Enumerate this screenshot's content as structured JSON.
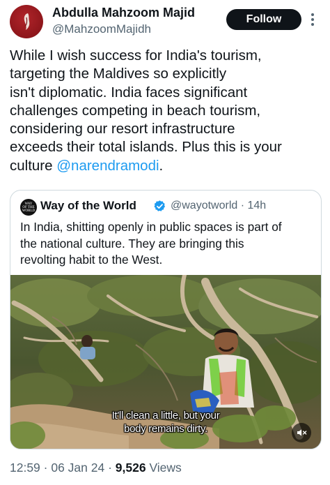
{
  "author": {
    "name": "Abdulla Mahzoom Majid",
    "handle": "@MahzoomMajidh",
    "avatar_color": "#8e161b"
  },
  "follow_label": "Follow",
  "tweet": {
    "lines": [
      "While I wish success for India's tourism,",
      "targeting the Maldives so explicitly",
      "isn't diplomatic. India faces significant",
      "challenges competing in beach tourism,",
      "considering our resort infrastructure",
      "exceeds their total islands. Plus this is your"
    ],
    "last_line_prefix": "culture ",
    "mention": "@narendramodi",
    "last_line_suffix": "."
  },
  "quoted": {
    "avatar_text": [
      "WAY",
      "OF THE",
      "WORLD"
    ],
    "name": "Way of the World",
    "handle_time": "@wayotworld · 14h",
    "lines": [
      "In India, shitting openly in public spaces is part of",
      "the national culture. They are bringing this",
      "revolting habit to the West."
    ],
    "video": {
      "subtitle_line1": "It'll clean a little, but your",
      "subtitle_line2": "body remains dirty."
    }
  },
  "meta": {
    "time_date": "12:59 · 06 Jan 24 · ",
    "views_count": "9,526",
    "views_label": " Views"
  },
  "colors": {
    "text": "#0f1419",
    "secondary": "#536471",
    "link": "#1d9bf0",
    "verified": "#1d9bf0"
  },
  "icons": [
    "more-icon",
    "verified-badge-icon",
    "mute-icon"
  ]
}
